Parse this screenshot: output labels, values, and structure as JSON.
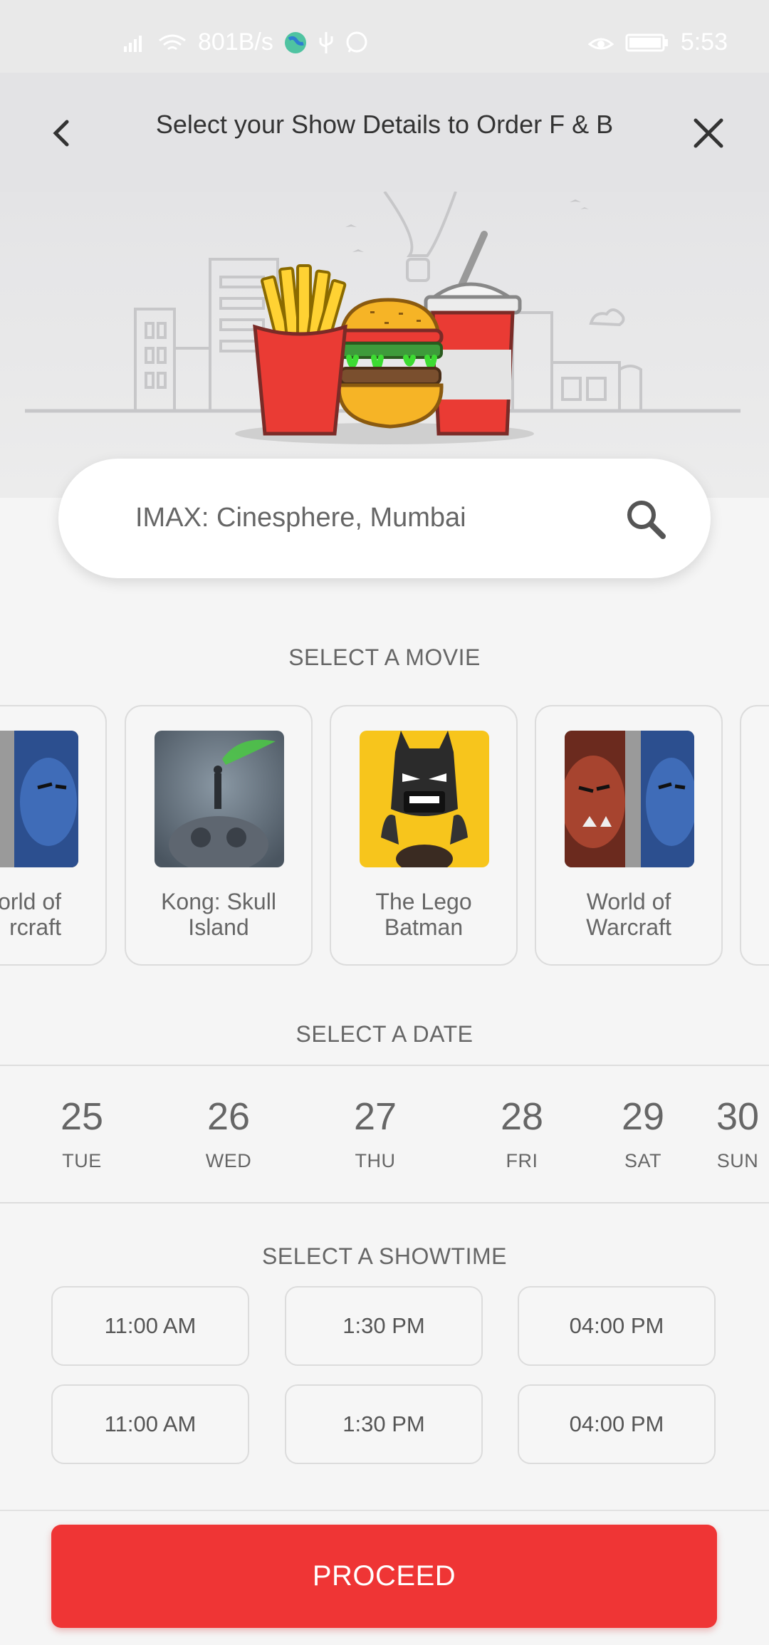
{
  "status_bar": {
    "network_speed": "801B/s",
    "time": "5:53",
    "icons": [
      "signal-icon",
      "wifi-icon",
      "globe-icon",
      "usb-icon",
      "whatsapp-icon",
      "eye-icon",
      "battery-icon"
    ]
  },
  "header": {
    "title": "Select your Show Details to Order F & B",
    "back_icon": "chevron-left-icon",
    "close_icon": "close-icon"
  },
  "search": {
    "value": "IMAX: Cinesphere, Mumbai",
    "icon": "search-icon"
  },
  "movies": {
    "section_title": "SELECT A MOVIE",
    "items": [
      {
        "name": "World of\nWarcraft",
        "visible_text": "orld of\nrcraft"
      },
      {
        "name": "Kong: Skull\nIsland"
      },
      {
        "name": "The Lego\nBatman"
      },
      {
        "name": "World of\nWarcraft"
      }
    ]
  },
  "dates": {
    "section_title": "SELECT A DATE",
    "items": [
      {
        "num": "25",
        "day": "TUE"
      },
      {
        "num": "26",
        "day": "WED"
      },
      {
        "num": "27",
        "day": "THU"
      },
      {
        "num": "28",
        "day": "FRI"
      },
      {
        "num": "29",
        "day": "SAT"
      },
      {
        "num": "30",
        "day": "SUN"
      }
    ]
  },
  "showtimes": {
    "section_title": "SELECT A SHOWTIME",
    "rows": [
      [
        "11:00 AM",
        "1:30 PM",
        "04:00 PM"
      ],
      [
        "11:00 AM",
        "1:30 PM",
        "04:00 PM"
      ]
    ]
  },
  "proceed_label": "PROCEED",
  "colors": {
    "accent": "#ef3535",
    "background": "#f5f5f5",
    "header_bg": "#e3e3e5"
  }
}
